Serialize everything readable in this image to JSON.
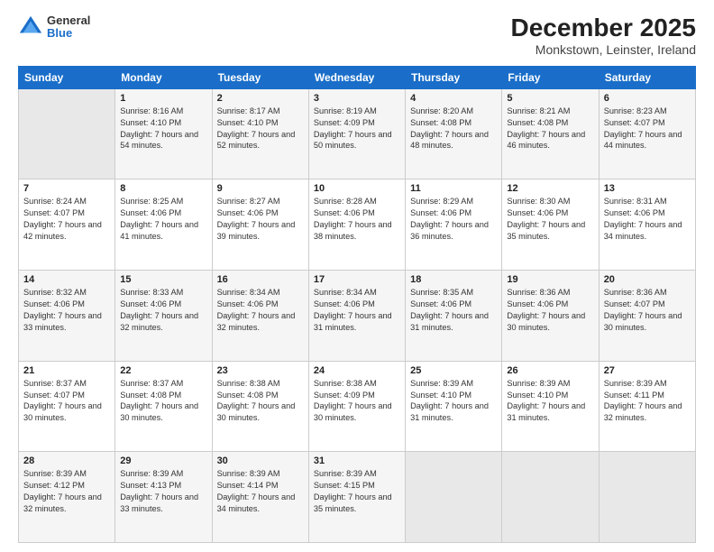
{
  "logo": {
    "general": "General",
    "blue": "Blue"
  },
  "header": {
    "month": "December 2025",
    "location": "Monkstown, Leinster, Ireland"
  },
  "days_of_week": [
    "Sunday",
    "Monday",
    "Tuesday",
    "Wednesday",
    "Thursday",
    "Friday",
    "Saturday"
  ],
  "weeks": [
    [
      {
        "num": "",
        "empty": true
      },
      {
        "num": "1",
        "sunrise": "8:16 AM",
        "sunset": "4:10 PM",
        "daylight": "7 hours and 54 minutes."
      },
      {
        "num": "2",
        "sunrise": "8:17 AM",
        "sunset": "4:10 PM",
        "daylight": "7 hours and 52 minutes."
      },
      {
        "num": "3",
        "sunrise": "8:19 AM",
        "sunset": "4:09 PM",
        "daylight": "7 hours and 50 minutes."
      },
      {
        "num": "4",
        "sunrise": "8:20 AM",
        "sunset": "4:08 PM",
        "daylight": "7 hours and 48 minutes."
      },
      {
        "num": "5",
        "sunrise": "8:21 AM",
        "sunset": "4:08 PM",
        "daylight": "7 hours and 46 minutes."
      },
      {
        "num": "6",
        "sunrise": "8:23 AM",
        "sunset": "4:07 PM",
        "daylight": "7 hours and 44 minutes."
      }
    ],
    [
      {
        "num": "7",
        "sunrise": "8:24 AM",
        "sunset": "4:07 PM",
        "daylight": "7 hours and 42 minutes."
      },
      {
        "num": "8",
        "sunrise": "8:25 AM",
        "sunset": "4:06 PM",
        "daylight": "7 hours and 41 minutes."
      },
      {
        "num": "9",
        "sunrise": "8:27 AM",
        "sunset": "4:06 PM",
        "daylight": "7 hours and 39 minutes."
      },
      {
        "num": "10",
        "sunrise": "8:28 AM",
        "sunset": "4:06 PM",
        "daylight": "7 hours and 38 minutes."
      },
      {
        "num": "11",
        "sunrise": "8:29 AM",
        "sunset": "4:06 PM",
        "daylight": "7 hours and 36 minutes."
      },
      {
        "num": "12",
        "sunrise": "8:30 AM",
        "sunset": "4:06 PM",
        "daylight": "7 hours and 35 minutes."
      },
      {
        "num": "13",
        "sunrise": "8:31 AM",
        "sunset": "4:06 PM",
        "daylight": "7 hours and 34 minutes."
      }
    ],
    [
      {
        "num": "14",
        "sunrise": "8:32 AM",
        "sunset": "4:06 PM",
        "daylight": "7 hours and 33 minutes."
      },
      {
        "num": "15",
        "sunrise": "8:33 AM",
        "sunset": "4:06 PM",
        "daylight": "7 hours and 32 minutes."
      },
      {
        "num": "16",
        "sunrise": "8:34 AM",
        "sunset": "4:06 PM",
        "daylight": "7 hours and 32 minutes."
      },
      {
        "num": "17",
        "sunrise": "8:34 AM",
        "sunset": "4:06 PM",
        "daylight": "7 hours and 31 minutes."
      },
      {
        "num": "18",
        "sunrise": "8:35 AM",
        "sunset": "4:06 PM",
        "daylight": "7 hours and 31 minutes."
      },
      {
        "num": "19",
        "sunrise": "8:36 AM",
        "sunset": "4:06 PM",
        "daylight": "7 hours and 30 minutes."
      },
      {
        "num": "20",
        "sunrise": "8:36 AM",
        "sunset": "4:07 PM",
        "daylight": "7 hours and 30 minutes."
      }
    ],
    [
      {
        "num": "21",
        "sunrise": "8:37 AM",
        "sunset": "4:07 PM",
        "daylight": "7 hours and 30 minutes."
      },
      {
        "num": "22",
        "sunrise": "8:37 AM",
        "sunset": "4:08 PM",
        "daylight": "7 hours and 30 minutes."
      },
      {
        "num": "23",
        "sunrise": "8:38 AM",
        "sunset": "4:08 PM",
        "daylight": "7 hours and 30 minutes."
      },
      {
        "num": "24",
        "sunrise": "8:38 AM",
        "sunset": "4:09 PM",
        "daylight": "7 hours and 30 minutes."
      },
      {
        "num": "25",
        "sunrise": "8:39 AM",
        "sunset": "4:10 PM",
        "daylight": "7 hours and 31 minutes."
      },
      {
        "num": "26",
        "sunrise": "8:39 AM",
        "sunset": "4:10 PM",
        "daylight": "7 hours and 31 minutes."
      },
      {
        "num": "27",
        "sunrise": "8:39 AM",
        "sunset": "4:11 PM",
        "daylight": "7 hours and 32 minutes."
      }
    ],
    [
      {
        "num": "28",
        "sunrise": "8:39 AM",
        "sunset": "4:12 PM",
        "daylight": "7 hours and 32 minutes."
      },
      {
        "num": "29",
        "sunrise": "8:39 AM",
        "sunset": "4:13 PM",
        "daylight": "7 hours and 33 minutes."
      },
      {
        "num": "30",
        "sunrise": "8:39 AM",
        "sunset": "4:14 PM",
        "daylight": "7 hours and 34 minutes."
      },
      {
        "num": "31",
        "sunrise": "8:39 AM",
        "sunset": "4:15 PM",
        "daylight": "7 hours and 35 minutes."
      },
      {
        "num": "",
        "empty": true
      },
      {
        "num": "",
        "empty": true
      },
      {
        "num": "",
        "empty": true
      }
    ]
  ],
  "labels": {
    "sunrise": "Sunrise:",
    "sunset": "Sunset:",
    "daylight": "Daylight:"
  }
}
